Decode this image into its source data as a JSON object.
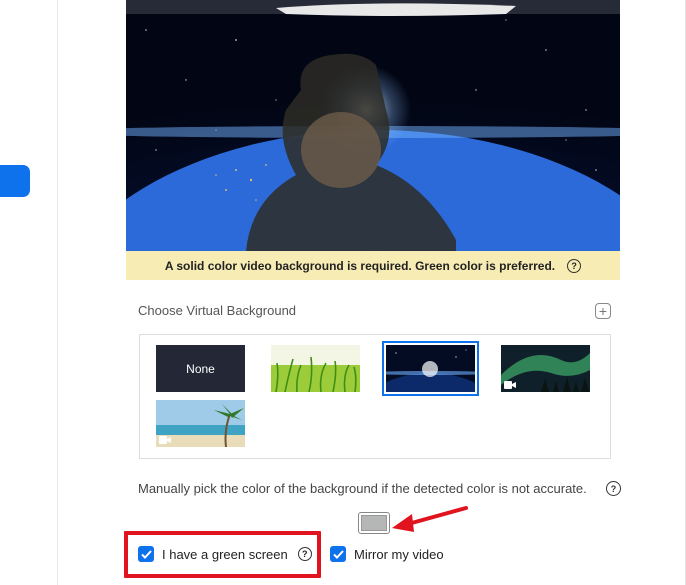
{
  "preview": {
    "warning_text": "A solid color video background is required. Green color is preferred.",
    "help_icon": "question-circle-icon"
  },
  "virtual_background": {
    "section_label": "Choose Virtual Background",
    "add_icon": "plus-icon",
    "items": [
      {
        "label": "None",
        "selected": false
      },
      {
        "label": "",
        "image": "grass",
        "selected": false
      },
      {
        "label": "",
        "image": "earth-space",
        "selected": true
      },
      {
        "label": "",
        "image": "aurora",
        "video": true,
        "selected": false
      },
      {
        "label": "",
        "image": "beach",
        "video": true,
        "selected": false
      }
    ]
  },
  "manual_color": {
    "text": "Manually pick the color of the background if the detected color is not accurate.",
    "swatch_color": "#b4b7b6"
  },
  "options": {
    "green_screen_label": "I have a green screen",
    "green_screen_checked": true,
    "mirror_label": "Mirror my video",
    "mirror_checked": true
  },
  "colors": {
    "accent": "#0e72ed",
    "warning_bg": "#f8ecb5",
    "highlight": "#e0131f"
  }
}
